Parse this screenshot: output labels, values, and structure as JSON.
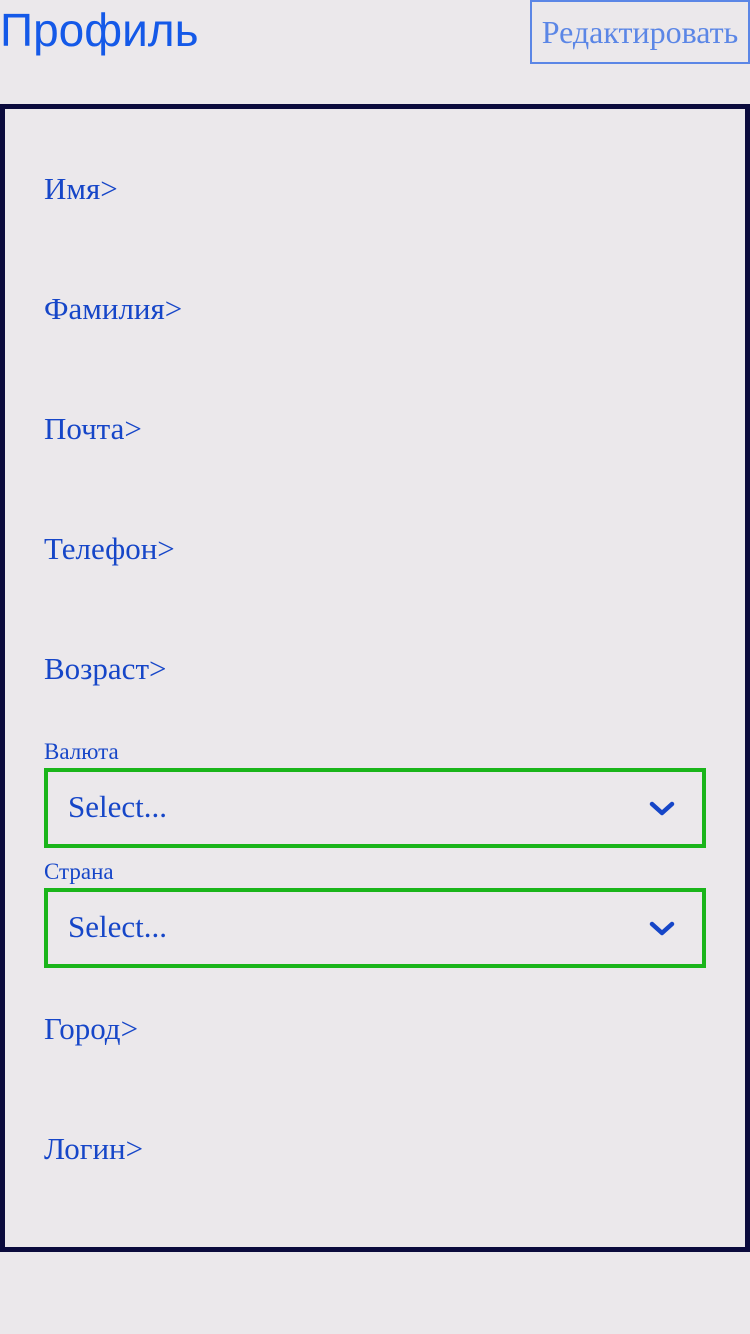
{
  "header": {
    "title": "Профиль",
    "edit_label": "Редактировать"
  },
  "fields": {
    "first_name": "Имя>",
    "last_name": "Фамилия>",
    "email": "Почта>",
    "phone": "Телефон>",
    "age": "Возраст>",
    "city": "Город>",
    "login": "Логин>"
  },
  "selects": {
    "currency": {
      "label": "Валюта",
      "value": "Select...",
      "icon": "chevron-down-icon"
    },
    "country": {
      "label": "Страна",
      "value": "Select...",
      "icon": "chevron-down-icon"
    }
  },
  "colors": {
    "background": "#ebe8eb",
    "accent": "#1459e8",
    "text": "#1646c8",
    "panel_border": "#0b0b3d",
    "select_border": "#1ab51a",
    "edit_button": "#5b86e6"
  }
}
